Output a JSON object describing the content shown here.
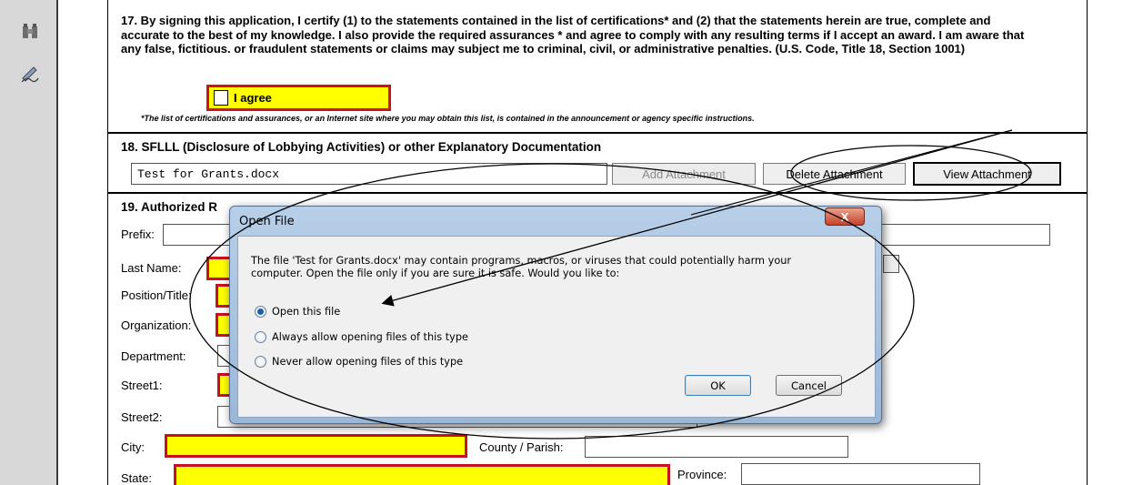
{
  "toolbar": {
    "icons": [
      "binoculars-icon",
      "sign-pen-icon"
    ]
  },
  "section17": {
    "text": "17. By signing this application, I certify (1) to the statements contained in the list of certifications* and (2) that the statements herein are true, complete and accurate to the best of my knowledge.  I also provide the required assurances * and agree to comply with any resulting terms if I accept an award.  I am aware that any false, fictitious. or fraudulent statements or claims may subject me to criminal, civil, or administrative penalties.  (U.S. Code, Title 18, Section 1001)",
    "agree_label": "I agree",
    "footnote": "*The list of certifications and assurances, or an Internet site where you may obtain this list, is contained in the announcement or agency specific instructions."
  },
  "section18": {
    "title": "18. SFLLL (Disclosure of Lobbying Activities) or other Explanatory Documentation",
    "file_value": "Test for Grants.docx",
    "add_label": "Add Attachment",
    "delete_label": "Delete Attachment",
    "view_label": "View Attachment"
  },
  "section19": {
    "title": "19. Authorized R",
    "labels": {
      "prefix": "Prefix:",
      "last_name": "Last Name:",
      "position": "Position/Title:",
      "organization": "Organization:",
      "department": "Department:",
      "street1": "Street1:",
      "street2": "Street2:",
      "city": "City:",
      "county": "County / Parish:",
      "state": "State:",
      "province": "Province:"
    }
  },
  "dialog": {
    "title": "Open File",
    "close_symbol": "X",
    "message": "The file 'Test for Grants.docx' may contain programs, macros, or viruses that could potentially harm your computer. Open the file only if you are sure it is safe. Would you like to:",
    "options": [
      "Open this file",
      "Always allow opening files of this type",
      "Never allow opening files of this type"
    ],
    "selected_option": 0,
    "ok_label": "OK",
    "cancel_label": "Cancel"
  },
  "colors": {
    "required_fill": "#ffff00",
    "required_border": "#c81020",
    "dialog_frame": "#9bb7d8"
  }
}
